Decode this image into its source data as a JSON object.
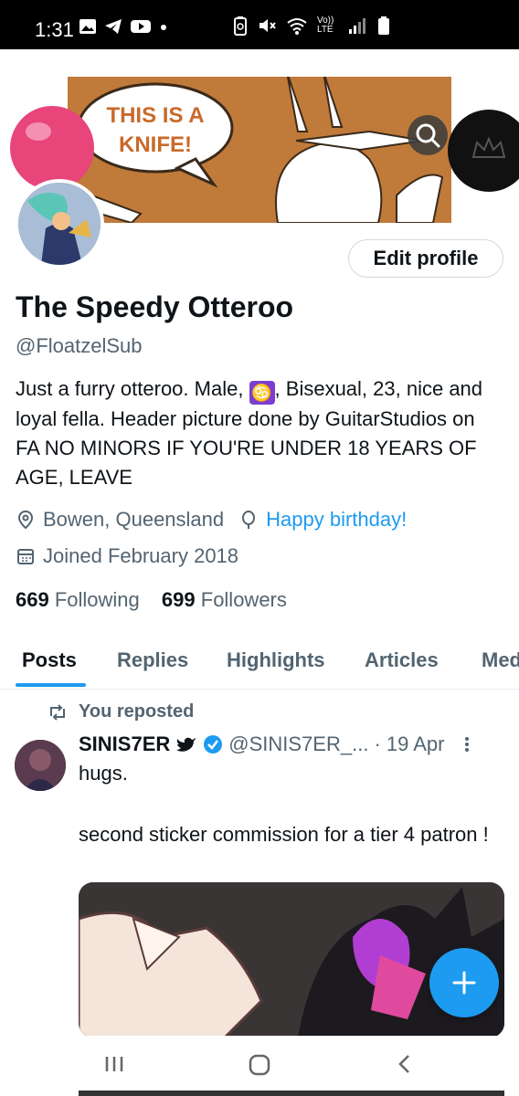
{
  "status_bar": {
    "time": "1:31",
    "icons": [
      "gallery-icon",
      "telegram-icon",
      "youtube-icon",
      "dot-icon",
      "battery-saver-icon",
      "mute-icon",
      "wifi-icon",
      "volte-icon",
      "signal-icon",
      "battery-icon"
    ],
    "volte_label": "Vo)) LTE"
  },
  "header": {
    "banner_text": "THIS IS A KNIFE!",
    "search_icon": "search-icon"
  },
  "profile": {
    "edit_label": "Edit profile",
    "name": "The Speedy Otteroo",
    "handle": "@FloatzelSub",
    "bio_part1": "Just a furry otteroo. Male, ",
    "bio_emoji": "♋",
    "bio_part2": ", Bisexual, 23, nice and loyal fella. Header picture done by GuitarStudios on FA NO MINORS IF YOU'RE UNDER 18 YEARS OF AGE, LEAVE",
    "location": "Bowen, Queensland",
    "birthday": "Happy birthday!",
    "joined": "Joined February 2018",
    "following_count": "669",
    "following_label": "Following",
    "followers_count": "699",
    "followers_label": "Followers"
  },
  "tabs": [
    "Posts",
    "Replies",
    "Highlights",
    "Articles",
    "Med"
  ],
  "post": {
    "repost_label": "You reposted",
    "author_name": "SINIS7ER",
    "author_handle": "@SINIS7ER_...",
    "time": "· 19 Apr",
    "text1": "hugs.",
    "text2": "second sticker commission for a tier 4 patron !"
  },
  "colors": {
    "accent": "#1d9bf0",
    "text": "#0f1419",
    "muted": "#536471",
    "banner": "#c07a3a"
  }
}
